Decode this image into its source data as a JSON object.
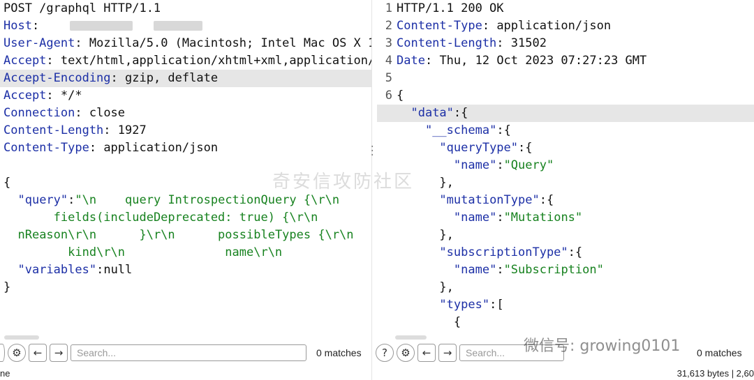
{
  "request": {
    "lines": [
      {
        "type": "plain",
        "text": "POST /graphql HTTP/1.1"
      },
      {
        "type": "header",
        "key": "Host",
        "value": ""
      },
      {
        "type": "header",
        "key": "User-Agent",
        "value": " Mozilla/5.0 (Macintosh; Intel Mac OS X 1("
      },
      {
        "type": "header",
        "key": "Accept",
        "value": " text/html,application/xhtml+xml,application/:"
      },
      {
        "type": "header",
        "key": "Accept-Encoding",
        "value": " gzip, deflate",
        "highlight": true
      },
      {
        "type": "header",
        "key": "Accept",
        "value": " */*"
      },
      {
        "type": "header",
        "key": "Connection",
        "value": " close"
      },
      {
        "type": "header",
        "key": "Content-Length",
        "value": " 1927"
      },
      {
        "type": "header",
        "key": "Content-Type",
        "value": " application/json"
      },
      {
        "type": "plain",
        "text": ""
      },
      {
        "type": "plain",
        "text": "{"
      },
      {
        "type": "json",
        "indent": "  ",
        "key": "\"query\"",
        "sep": ":",
        "value": "\"\\n    query IntrospectionQuery {\\r\\n"
      },
      {
        "type": "cont",
        "indent": "       ",
        "value": "fields(includeDeprecated: true) {\\r\\n        i"
      },
      {
        "type": "cont",
        "indent": "  ",
        "value": "nReason\\r\\n      }\\r\\n      possibleTypes {\\r\\n"
      },
      {
        "type": "cont",
        "indent": "         ",
        "value": "kind\\r\\n              name\\r\\n"
      },
      {
        "type": "json",
        "indent": "  ",
        "key": "\"variables\"",
        "sep": ":",
        "value": "null",
        "plainValue": true
      },
      {
        "type": "plain",
        "text": "}"
      }
    ]
  },
  "response": {
    "lines": [
      {
        "num": "1",
        "type": "plain",
        "text": "HTTP/1.1 200 OK"
      },
      {
        "num": "2",
        "type": "header",
        "key": "Content-Type",
        "value": " application/json"
      },
      {
        "num": "3",
        "type": "header",
        "key": "Content-Length",
        "value": " 31502"
      },
      {
        "num": "4",
        "type": "header",
        "key": "Date",
        "value": " Thu, 12 Oct 2023 07:27:23 GMT"
      },
      {
        "num": "5",
        "type": "plain",
        "text": ""
      },
      {
        "num": "6",
        "type": "plain",
        "text": "{"
      },
      {
        "num": "",
        "type": "json",
        "indent": "  ",
        "key": "\"data\"",
        "sep": ":",
        "value": "{",
        "plainValue": true,
        "highlight": true
      },
      {
        "num": "",
        "type": "json",
        "indent": "    ",
        "key": "\"__schema\"",
        "sep": ":",
        "value": "{",
        "plainValue": true
      },
      {
        "num": "",
        "type": "json",
        "indent": "      ",
        "key": "\"queryType\"",
        "sep": ":",
        "value": "{",
        "plainValue": true
      },
      {
        "num": "",
        "type": "json",
        "indent": "        ",
        "key": "\"name\"",
        "sep": ":",
        "value": "\"Query\""
      },
      {
        "num": "",
        "type": "plain",
        "text": "      },"
      },
      {
        "num": "",
        "type": "json",
        "indent": "      ",
        "key": "\"mutationType\"",
        "sep": ":",
        "value": "{",
        "plainValue": true
      },
      {
        "num": "",
        "type": "json",
        "indent": "        ",
        "key": "\"name\"",
        "sep": ":",
        "value": "\"Mutations\""
      },
      {
        "num": "",
        "type": "plain",
        "text": "      },"
      },
      {
        "num": "",
        "type": "json",
        "indent": "      ",
        "key": "\"subscriptionType\"",
        "sep": ":",
        "value": "{",
        "plainValue": true
      },
      {
        "num": "",
        "type": "json",
        "indent": "        ",
        "key": "\"name\"",
        "sep": ":",
        "value": "\"Subscription\""
      },
      {
        "num": "",
        "type": "plain",
        "text": "      },"
      },
      {
        "num": "",
        "type": "json",
        "indent": "      ",
        "key": "\"types\"",
        "sep": ":",
        "value": "[",
        "plainValue": true
      },
      {
        "num": "",
        "type": "plain",
        "text": "        {"
      }
    ]
  },
  "left_bar": {
    "search_placeholder": "Search...",
    "matches": "0 matches"
  },
  "right_bar": {
    "search_placeholder": "Search...",
    "matches": "0 matches"
  },
  "status": {
    "left": "ne",
    "right": "31,613 bytes | 2,60"
  },
  "watermark": {
    "center": "奇安信攻防社区",
    "corner": "微信号: growing0101"
  },
  "icons": {
    "help": "help-icon",
    "settings": "gear-icon",
    "prev": "arrow-left-icon",
    "next": "arrow-right-icon"
  }
}
